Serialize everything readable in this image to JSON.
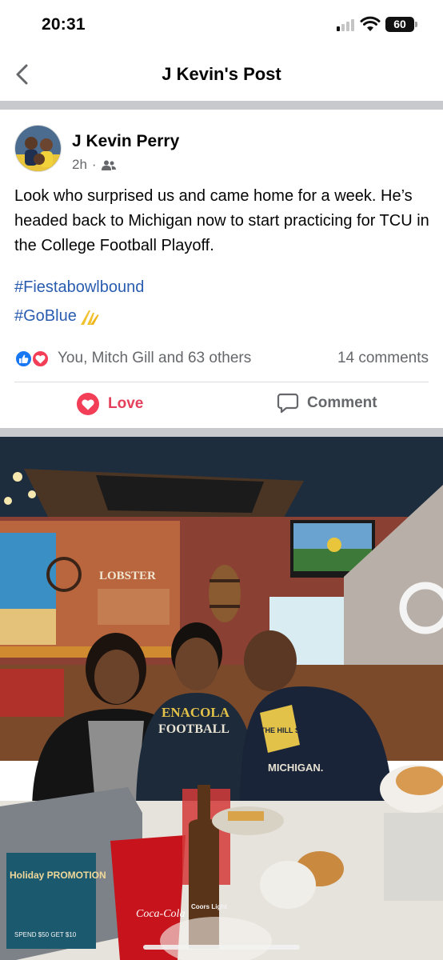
{
  "status_bar": {
    "time": "20:31",
    "battery": "60"
  },
  "header": {
    "title": "J Kevin's Post",
    "back_icon": "chevron-left-icon"
  },
  "post": {
    "author": "J Kevin Perry",
    "time": "2h",
    "separator": "·",
    "audience_icon": "friends-icon",
    "text": "Look who surprised us and came home for a week. He’s headed back to Michigan now to start practicing for TCU in the College Football Playoff.",
    "hashtags": [
      "#Fiestabowlbound",
      "#GoBlue"
    ],
    "hashtag_emoji": "victory-hand-emoji",
    "reactions": {
      "summary": "You, Mitch Gill and 63 others",
      "comments": "14 comments",
      "icons": [
        "like-icon",
        "love-icon"
      ]
    },
    "actions": {
      "love_label": "Love",
      "comment_label": "Comment"
    }
  },
  "photo": {
    "restaurant_sign": "LOBSTER",
    "shirt_left": "ENACOLA",
    "shirt_left_2": "FOOTBALL",
    "shirt_right": "THE HILL SATE",
    "shirt_right_2": "MICHIGAN.",
    "cup_text": "Coca-Cola",
    "promo_title": "Holiday PROMOTION",
    "promo_sub": "SPEND $50 GET $10",
    "beer_label": "Coors Light"
  },
  "colors": {
    "link": "#2a5db0",
    "love": "#e4405b",
    "like": "#1877f2",
    "muted": "#65676b",
    "divider": "#c8c9cc"
  }
}
